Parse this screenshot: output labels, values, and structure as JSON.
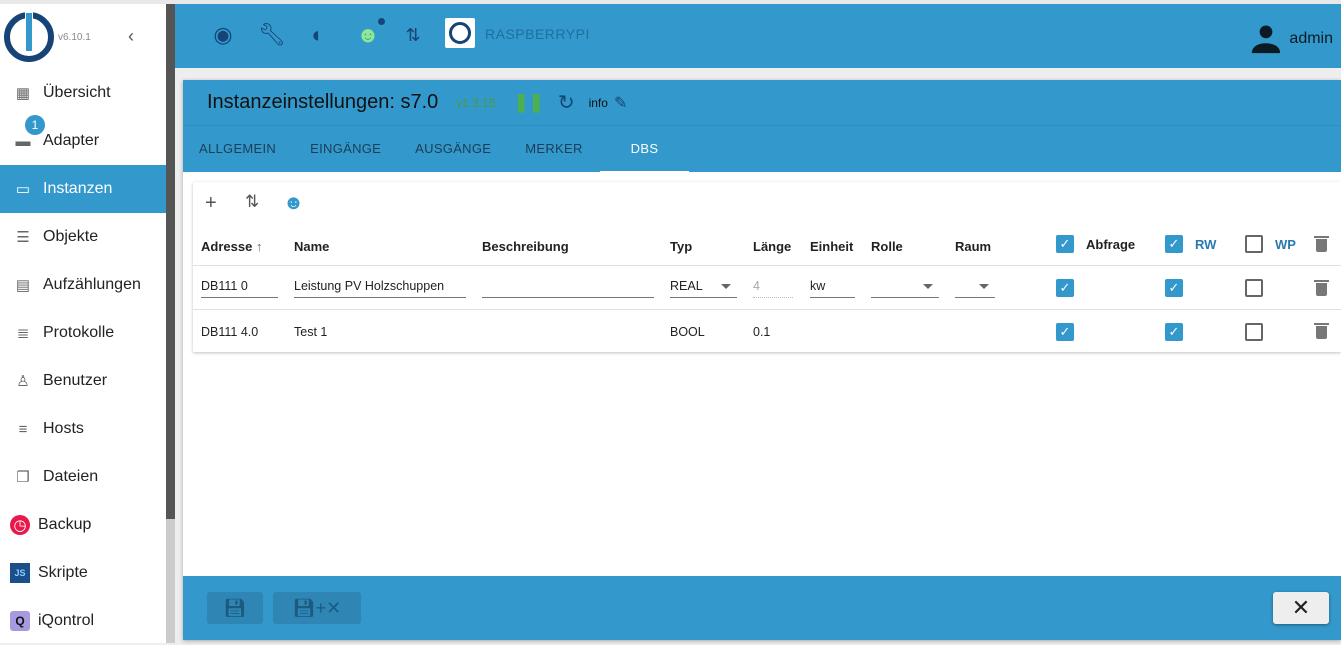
{
  "app": {
    "version": "v6.10.1",
    "host": "RASPBERRYPI",
    "user": "admin"
  },
  "sidebar": {
    "items": [
      {
        "label": "Übersicht",
        "icon": "grid-icon"
      },
      {
        "label": "Adapter",
        "icon": "store-icon",
        "badge": "1"
      },
      {
        "label": "Instanzen",
        "icon": "instances-icon"
      },
      {
        "label": "Objekte",
        "icon": "list-icon"
      },
      {
        "label": "Aufzählungen",
        "icon": "enum-icon"
      },
      {
        "label": "Protokolle",
        "icon": "log-icon"
      },
      {
        "label": "Benutzer",
        "icon": "user-icon"
      },
      {
        "label": "Hosts",
        "icon": "hosts-icon"
      },
      {
        "label": "Dateien",
        "icon": "files-icon"
      },
      {
        "label": "Backup",
        "icon": "backup-icon"
      },
      {
        "label": "Skripte",
        "icon": "js-icon"
      },
      {
        "label": "iQontrol",
        "icon": "iqontrol-icon"
      }
    ]
  },
  "card": {
    "title": "Instanzeinstellungen: s7.0",
    "version": "v1.3.15",
    "info": "info",
    "tabs": [
      "ALLGEMEIN",
      "EINGÄNGE",
      "AUSGÄNGE",
      "MERKER",
      "DBS"
    ]
  },
  "table": {
    "headers": {
      "adresse": "Adresse",
      "name": "Name",
      "beschreibung": "Beschreibung",
      "typ": "Typ",
      "laenge": "Länge",
      "einheit": "Einheit",
      "rolle": "Rolle",
      "raum": "Raum",
      "abfrage": "Abfrage",
      "rw": "RW",
      "wp": "WP"
    },
    "rows": [
      {
        "adresse": "DB111 0",
        "name": "Leistung PV Holzschuppen",
        "beschreibung": "",
        "typ": "REAL",
        "laenge": "4",
        "einheit": "kw",
        "rolle": "",
        "raum": "",
        "abfrage": true,
        "rw": true,
        "wp": false
      },
      {
        "adresse": "DB111 4.0",
        "name": "Test 1",
        "beschreibung": "",
        "typ": "BOOL",
        "laenge": "0.1",
        "einheit": "",
        "rolle": "",
        "raum": "",
        "abfrage": true,
        "rw": true,
        "wp": false
      }
    ]
  },
  "colors": {
    "primary": "#3399cc",
    "dark": "#164477"
  }
}
